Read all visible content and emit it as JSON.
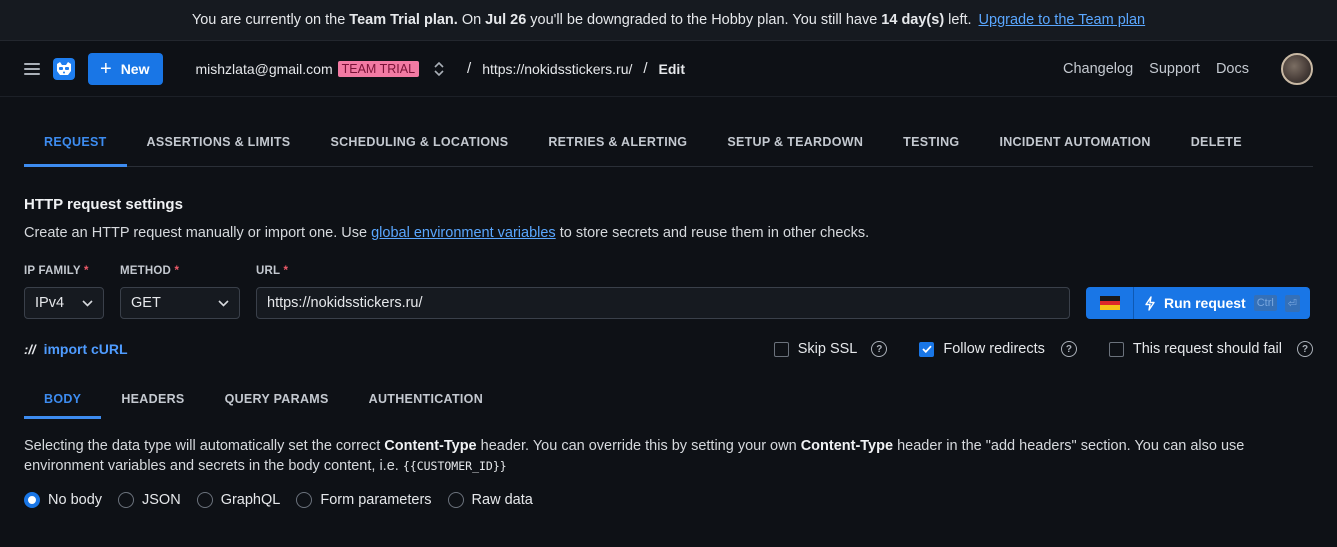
{
  "banner": {
    "part1": "You are currently on the",
    "plan": "Team Trial plan.",
    "part2": "On",
    "date": "Jul 26",
    "part3": "you'll be downgraded to the Hobby plan. You still have",
    "days": "14 day(s)",
    "part4": "left.",
    "link": "Upgrade to the Team plan"
  },
  "topbar": {
    "new_label": "New",
    "account": "mishzlata@gmail.com",
    "badge": "TEAM TRIAL",
    "crumbs": [
      "https://nokidsstickers.ru/",
      "Edit"
    ],
    "links": [
      "Changelog",
      "Support",
      "Docs"
    ]
  },
  "tabs": [
    "REQUEST",
    "ASSERTIONS & LIMITS",
    "SCHEDULING & LOCATIONS",
    "RETRIES & ALERTING",
    "SETUP & TEARDOWN",
    "TESTING",
    "INCIDENT AUTOMATION",
    "DELETE"
  ],
  "section": {
    "title": "HTTP request settings",
    "desc_before": "Create an HTTP request manually or import one. Use",
    "desc_link": "global environment variables",
    "desc_after": "to store secrets and reuse them in other checks."
  },
  "form": {
    "ip_label": "IP FAMILY",
    "ip_value": "IPv4",
    "method_label": "METHOD",
    "method_value": "GET",
    "url_label": "URL",
    "url_value": "https://nokidsstickers.ru/",
    "required_mark": "*",
    "run_label": "Run request",
    "kbd_ctrl": "Ctrl",
    "kbd_enter": "⏎"
  },
  "options": {
    "import_slashes": "://",
    "import_label": "import cURL",
    "skip_ssl": "Skip SSL",
    "follow_redirects": "Follow redirects",
    "should_fail": "This request should fail",
    "skip_ssl_checked": false,
    "follow_redirects_checked": true,
    "should_fail_checked": false
  },
  "subtabs": [
    "BODY",
    "HEADERS",
    "QUERY PARAMS",
    "AUTHENTICATION"
  ],
  "body": {
    "t1": "Selecting the data type will automatically set the correct",
    "b1": "Content-Type",
    "t2": "header. You can override this by setting your own",
    "b2": "Content-Type",
    "t3": "header in the \"add headers\" section. You can also use environment variables and secrets in the body content, i.e.",
    "code": "{{CUSTOMER_ID}}"
  },
  "radios": [
    "No body",
    "JSON",
    "GraphQL",
    "Form parameters",
    "Raw data"
  ],
  "radio_selected": "No body",
  "colors": {
    "accent": "#1976e6",
    "link": "#5aa7ff",
    "badge": "#f27aa3",
    "background": "#0e1116"
  },
  "icons": {
    "menu": "hamburger-icon",
    "logo": "raccoon-logo-icon",
    "run": "lightning-icon",
    "help": "question-circle-icon",
    "flag": "germany-flag-icon"
  }
}
